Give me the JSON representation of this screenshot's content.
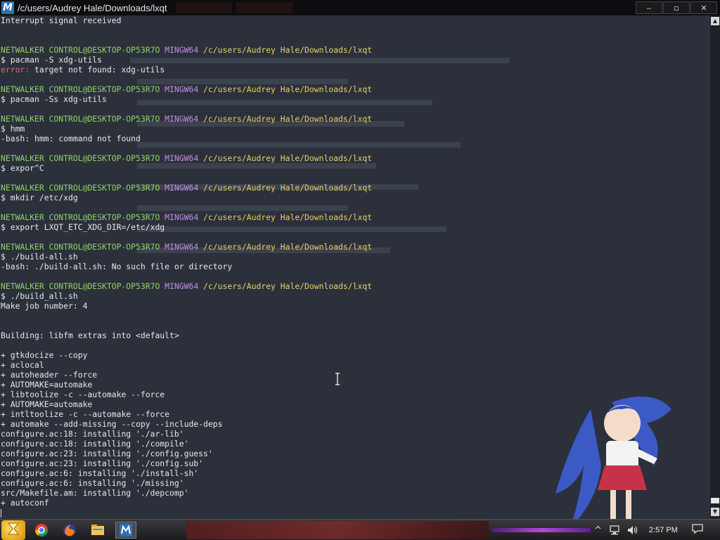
{
  "window": {
    "icon_letter": "M",
    "title": "/c/users/Audrey Hale/Downloads/lxqt",
    "controls": {
      "minimize": "‒",
      "maximize": "▫",
      "close": "✕"
    }
  },
  "terminal": {
    "lines": [
      {
        "parts": [
          {
            "text": "Interrupt signal received",
            "cls": ""
          }
        ]
      },
      {
        "parts": [
          {
            "text": "",
            "cls": ""
          }
        ]
      },
      {
        "parts": [
          {
            "text": "",
            "cls": ""
          }
        ]
      },
      {
        "parts": [
          {
            "text": "NETWALKER CONTROL@DESKTOP-OP53R7O ",
            "cls": "c-green"
          },
          {
            "text": "MINGW64 ",
            "cls": "c-purple"
          },
          {
            "text": "/c/users/Audrey Hale/Downloads/lxqt",
            "cls": "c-yellow"
          }
        ]
      },
      {
        "parts": [
          {
            "text": "$ pacman -S xdg-utils",
            "cls": ""
          }
        ]
      },
      {
        "parts": [
          {
            "text": "error:",
            "cls": "c-red"
          },
          {
            "text": " target not found: xdg-utils",
            "cls": ""
          }
        ]
      },
      {
        "parts": [
          {
            "text": "",
            "cls": ""
          }
        ]
      },
      {
        "parts": [
          {
            "text": "NETWALKER CONTROL@DESKTOP-OP53R7O ",
            "cls": "c-green"
          },
          {
            "text": "MINGW64 ",
            "cls": "c-purple"
          },
          {
            "text": "/c/users/Audrey Hale/Downloads/lxqt",
            "cls": "c-yellow"
          }
        ]
      },
      {
        "parts": [
          {
            "text": "$ pacman -Ss xdg-utils",
            "cls": ""
          }
        ]
      },
      {
        "parts": [
          {
            "text": "",
            "cls": ""
          }
        ]
      },
      {
        "parts": [
          {
            "text": "NETWALKER CONTROL@DESKTOP-OP53R7O ",
            "cls": "c-green"
          },
          {
            "text": "MINGW64 ",
            "cls": "c-purple"
          },
          {
            "text": "/c/users/Audrey Hale/Downloads/lxqt",
            "cls": "c-yellow"
          }
        ]
      },
      {
        "parts": [
          {
            "text": "$ hmm",
            "cls": ""
          }
        ]
      },
      {
        "parts": [
          {
            "text": "-bash: hmm: command not found",
            "cls": ""
          }
        ]
      },
      {
        "parts": [
          {
            "text": "",
            "cls": ""
          }
        ]
      },
      {
        "parts": [
          {
            "text": "NETWALKER CONTROL@DESKTOP-OP53R7O ",
            "cls": "c-green"
          },
          {
            "text": "MINGW64 ",
            "cls": "c-purple"
          },
          {
            "text": "/c/users/Audrey Hale/Downloads/lxqt",
            "cls": "c-yellow"
          }
        ]
      },
      {
        "parts": [
          {
            "text": "$ expor^C",
            "cls": ""
          }
        ]
      },
      {
        "parts": [
          {
            "text": "",
            "cls": ""
          }
        ]
      },
      {
        "parts": [
          {
            "text": "NETWALKER CONTROL@DESKTOP-OP53R7O ",
            "cls": "c-green"
          },
          {
            "text": "MINGW64 ",
            "cls": "c-purple"
          },
          {
            "text": "/c/users/Audrey Hale/Downloads/lxqt",
            "cls": "c-yellow"
          }
        ]
      },
      {
        "parts": [
          {
            "text": "$ mkdir /etc/xdg",
            "cls": ""
          }
        ]
      },
      {
        "parts": [
          {
            "text": "",
            "cls": ""
          }
        ]
      },
      {
        "parts": [
          {
            "text": "NETWALKER CONTROL@DESKTOP-OP53R7O ",
            "cls": "c-green"
          },
          {
            "text": "MINGW64 ",
            "cls": "c-purple"
          },
          {
            "text": "/c/users/Audrey Hale/Downloads/lxqt",
            "cls": "c-yellow"
          }
        ]
      },
      {
        "parts": [
          {
            "text": "$ export LXQT_ETC_XDG_DIR=/etc/xdg",
            "cls": ""
          }
        ]
      },
      {
        "parts": [
          {
            "text": "",
            "cls": ""
          }
        ]
      },
      {
        "parts": [
          {
            "text": "NETWALKER CONTROL@DESKTOP-OP53R7O ",
            "cls": "c-green"
          },
          {
            "text": "MINGW64 ",
            "cls": "c-purple"
          },
          {
            "text": "/c/users/Audrey Hale/Downloads/lxqt",
            "cls": "c-yellow"
          }
        ]
      },
      {
        "parts": [
          {
            "text": "$ ./build-all.sh",
            "cls": ""
          }
        ]
      },
      {
        "parts": [
          {
            "text": "-bash: ./build-all.sh: No such file or directory",
            "cls": ""
          }
        ]
      },
      {
        "parts": [
          {
            "text": "",
            "cls": ""
          }
        ]
      },
      {
        "parts": [
          {
            "text": "NETWALKER CONTROL@DESKTOP-OP53R7O ",
            "cls": "c-green"
          },
          {
            "text": "MINGW64 ",
            "cls": "c-purple"
          },
          {
            "text": "/c/users/Audrey Hale/Downloads/lxqt",
            "cls": "c-yellow"
          }
        ]
      },
      {
        "parts": [
          {
            "text": "$ ./build_all.sh",
            "cls": ""
          }
        ]
      },
      {
        "parts": [
          {
            "text": "Make job number: 4",
            "cls": ""
          }
        ]
      },
      {
        "parts": [
          {
            "text": "",
            "cls": ""
          }
        ]
      },
      {
        "parts": [
          {
            "text": "",
            "cls": ""
          }
        ]
      },
      {
        "parts": [
          {
            "text": "Building: libfm extras into <default>",
            "cls": ""
          }
        ]
      },
      {
        "parts": [
          {
            "text": "",
            "cls": ""
          }
        ]
      },
      {
        "parts": [
          {
            "text": "+ gtkdocize --copy",
            "cls": ""
          }
        ]
      },
      {
        "parts": [
          {
            "text": "+ aclocal",
            "cls": ""
          }
        ]
      },
      {
        "parts": [
          {
            "text": "+ autoheader --force",
            "cls": ""
          }
        ]
      },
      {
        "parts": [
          {
            "text": "+ AUTOMAKE=automake",
            "cls": ""
          }
        ]
      },
      {
        "parts": [
          {
            "text": "+ libtoolize -c --automake --force",
            "cls": ""
          }
        ]
      },
      {
        "parts": [
          {
            "text": "+ AUTOMAKE=automake",
            "cls": ""
          }
        ]
      },
      {
        "parts": [
          {
            "text": "+ intltoolize -c --automake --force",
            "cls": ""
          }
        ]
      },
      {
        "parts": [
          {
            "text": "+ automake --add-missing --copy --include-deps",
            "cls": ""
          }
        ]
      },
      {
        "parts": [
          {
            "text": "configure.ac:18: installing './ar-lib'",
            "cls": ""
          }
        ]
      },
      {
        "parts": [
          {
            "text": "configure.ac:18: installing './compile'",
            "cls": ""
          }
        ]
      },
      {
        "parts": [
          {
            "text": "configure.ac:23: installing './config.guess'",
            "cls": ""
          }
        ]
      },
      {
        "parts": [
          {
            "text": "configure.ac:23: installing './config.sub'",
            "cls": ""
          }
        ]
      },
      {
        "parts": [
          {
            "text": "configure.ac:6: installing './install-sh'",
            "cls": ""
          }
        ]
      },
      {
        "parts": [
          {
            "text": "configure.ac:6: installing './missing'",
            "cls": ""
          }
        ]
      },
      {
        "parts": [
          {
            "text": "src/Makefile.am: installing './depcomp'",
            "cls": ""
          }
        ]
      },
      {
        "parts": [
          {
            "text": "+ autoconf",
            "cls": ""
          }
        ]
      }
    ]
  },
  "taskbar": {
    "clock": "2:57 PM",
    "icons": [
      "start-icon",
      "chrome-icon",
      "firefox-icon",
      "file-explorer-icon",
      "mintty-icon"
    ]
  },
  "colors": {
    "terminal_bg": "#2b303a",
    "prompt_user": "#8fd26a",
    "prompt_shell": "#c58ee8",
    "prompt_path": "#e7cf6a",
    "error": "#e06c6c"
  }
}
